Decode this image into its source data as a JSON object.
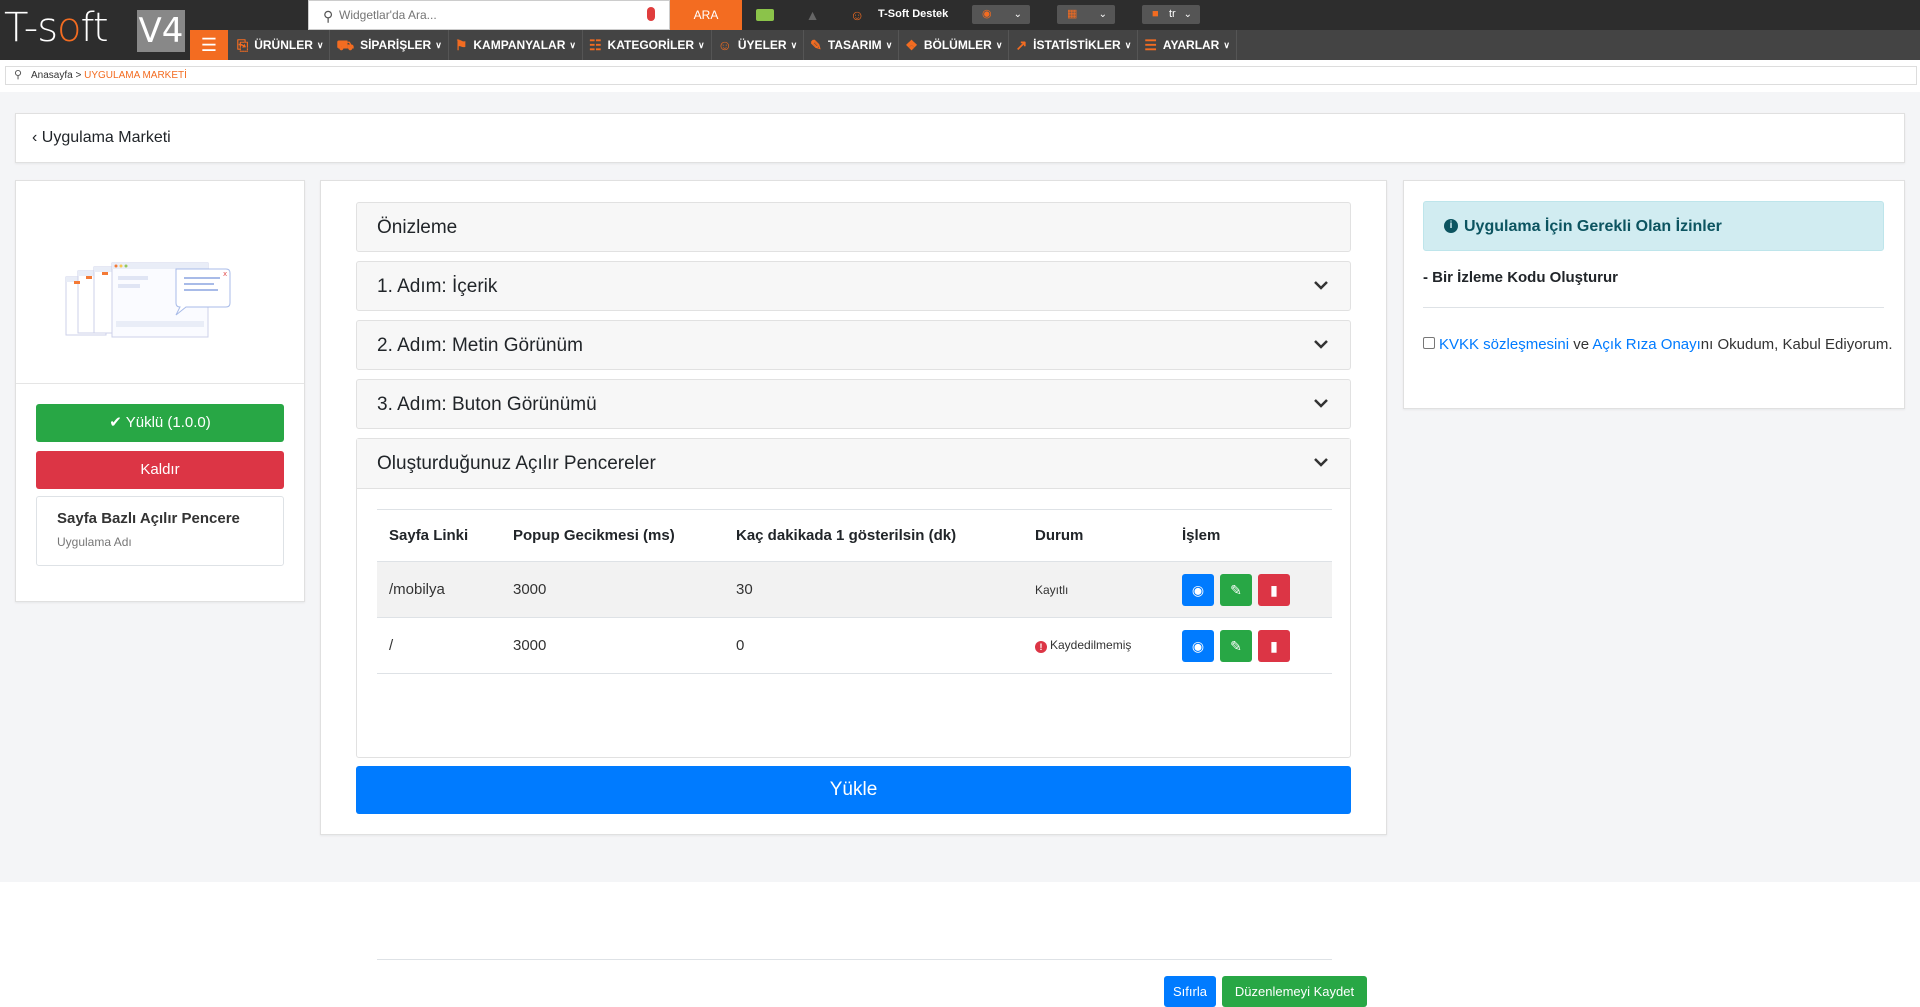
{
  "topbar": {
    "logo_text_left": "T-s",
    "logo_text_o": "o",
    "logo_text_right": "ft",
    "logo_version": "V4",
    "search_placeholder": "Widgetlar'da Ara...",
    "search_button": "ARA",
    "user_name": "T-Soft Destek",
    "language": "tr"
  },
  "nav": {
    "items": [
      {
        "label": "ÜRÜNLER",
        "icon": "box-icon"
      },
      {
        "label": "SİPARİŞLER",
        "icon": "cart-icon"
      },
      {
        "label": "KAMPANYALAR",
        "icon": "tag-icon"
      },
      {
        "label": "KATEGORİLER",
        "icon": "sitemap-icon"
      },
      {
        "label": "ÜYELER",
        "icon": "users-icon"
      },
      {
        "label": "TASARIM",
        "icon": "brush-icon"
      },
      {
        "label": "BÖLÜMLER",
        "icon": "sections-icon"
      },
      {
        "label": "İSTATİSTİKLER",
        "icon": "chart-icon"
      },
      {
        "label": "AYARLAR",
        "icon": "settings-icon"
      }
    ]
  },
  "breadcrumb": {
    "home": "Anasayfa",
    "separator": ">",
    "current": "UYGULAMA MARKETİ"
  },
  "back": {
    "label": "Uygulama Marketi"
  },
  "app": {
    "installed_label": "Yüklü (1.0.0)",
    "remove_label": "Kaldır",
    "name": "Sayfa Bazlı Açılır Pencere",
    "subtitle": "Uygulama Adı"
  },
  "accordion": {
    "preview": "Önizleme",
    "step1": "1. Adım: İçerik",
    "step2": "2. Adım: Metin Görünüm",
    "step3": "3. Adım: Buton Görünümü",
    "popups": "Oluşturduğunuz Açılır Pencereler"
  },
  "table": {
    "headers": [
      "Sayfa Linki",
      "Popup Gecikmesi (ms)",
      "Kaç dakikada 1 gösterilsin (dk)",
      "Durum",
      "İşlem"
    ],
    "rows": [
      {
        "link": "/mobilya",
        "delay": "3000",
        "interval": "30",
        "status": "Kayıtlı"
      },
      {
        "link": "/",
        "delay": "3000",
        "interval": "0",
        "status": "Kaydedilmemiş"
      }
    ],
    "reset_label": "Sıfırla",
    "save_label": "Düzenlemeyi Kaydet"
  },
  "upload_label": "Yükle",
  "permissions": {
    "title": "Uygulama İçin Gerekli Olan İzinler",
    "item": "- Bir İzleme Kodu Oluşturur",
    "kvkk_link": "KVKK sözleşmesini",
    "kvkk_and": "ve",
    "consent_link": "Açık Rıza Onayı",
    "consent_rest": "nı Okudum, Kabul Ediyorum."
  },
  "colors": {
    "brand": "#f36c21",
    "primary": "#007bff",
    "success": "#28a745",
    "danger": "#dc3545",
    "info_bg": "#d1ecf1"
  }
}
